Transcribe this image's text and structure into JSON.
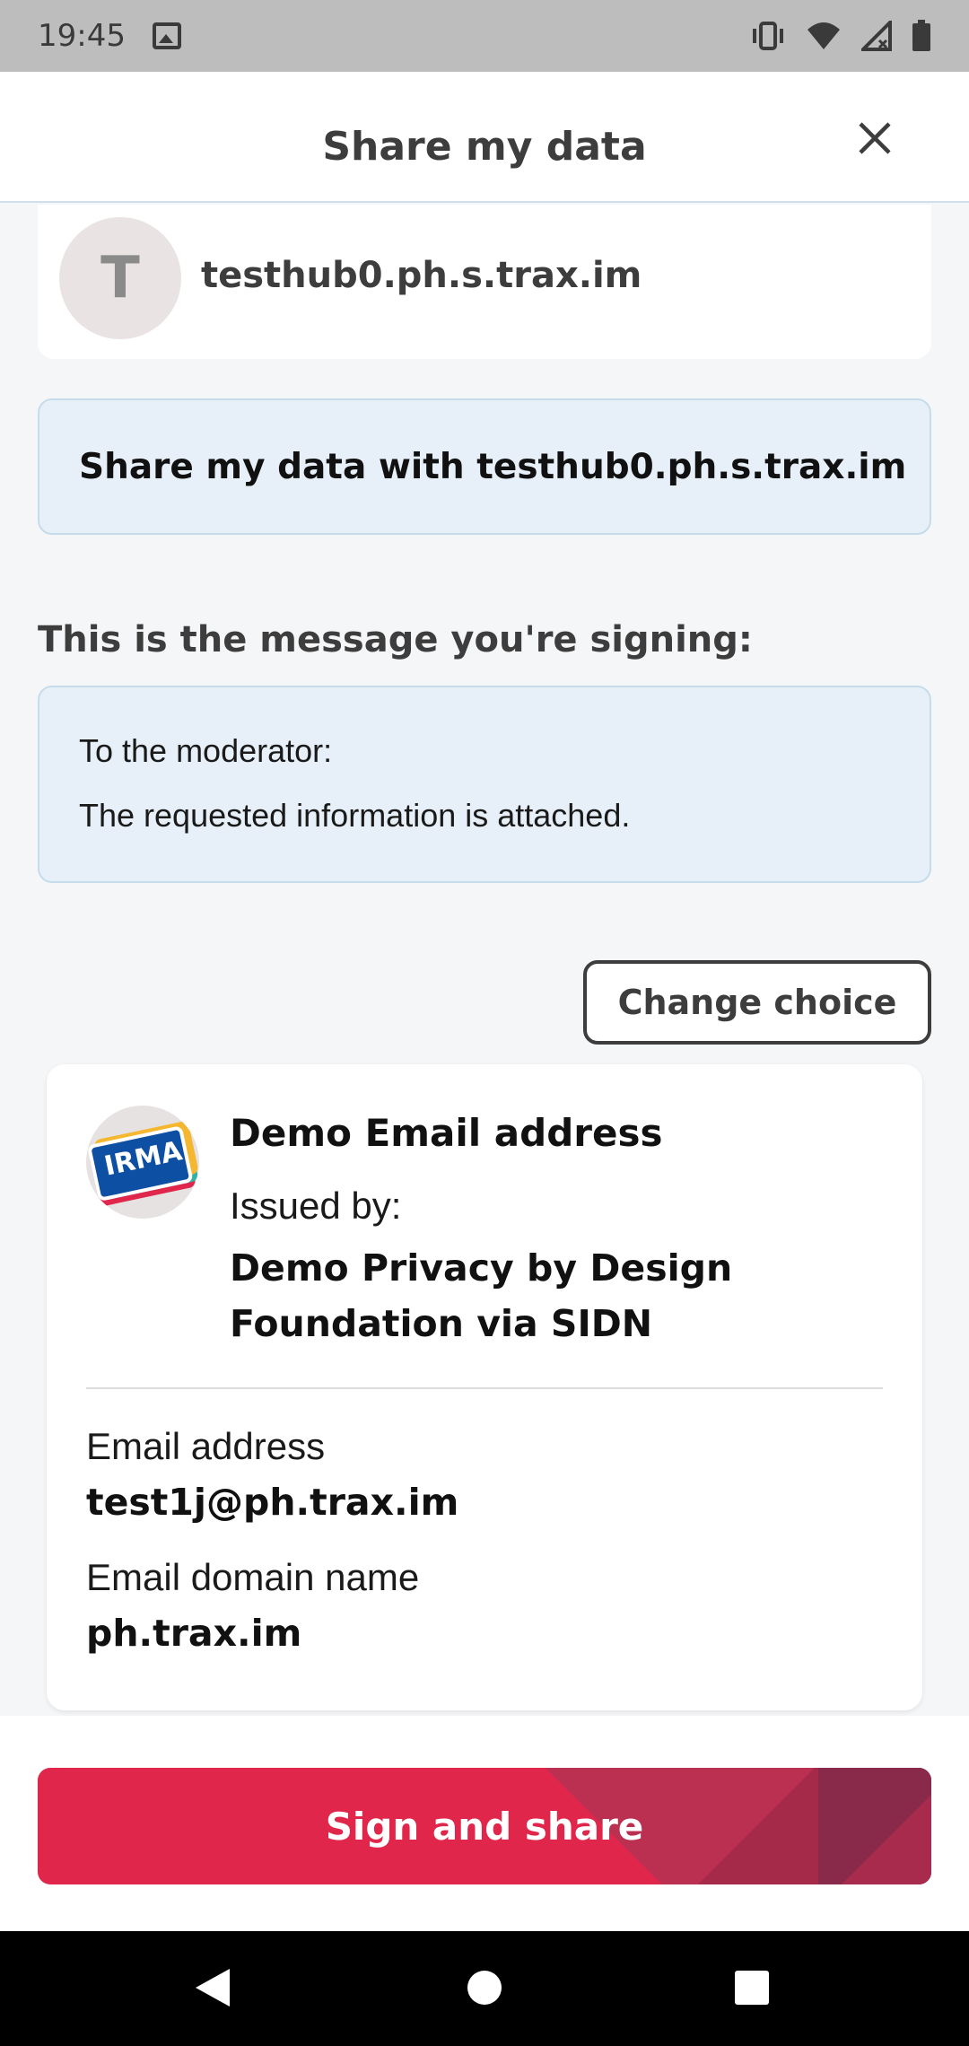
{
  "status_bar": {
    "time": "19:45",
    "icons": [
      "gallery-icon",
      "vibrate-icon",
      "wifi-icon",
      "signal-icon",
      "battery-icon"
    ]
  },
  "header": {
    "title": "Share my data",
    "close_icon": "close-icon"
  },
  "requestor": {
    "avatar_letter": "T",
    "name": "testhub0.ph.s.trax.im"
  },
  "share_box": {
    "text": "Share my data with testhub0.ph.s.trax.im"
  },
  "message": {
    "label": "This is the message you're signing:",
    "lines": [
      "To the moderator:",
      "The requested information is attached."
    ]
  },
  "change_choice": {
    "label": "Change choice"
  },
  "credential": {
    "logo_text": "IRMA",
    "title": "Demo Email address",
    "issued_by_label": "Issued by:",
    "issuer": "Demo Privacy by Design Foundation via SIDN",
    "attributes": [
      {
        "label": "Email address",
        "value": "test1j@ph.trax.im"
      },
      {
        "label": "Email domain name",
        "value": "ph.trax.im"
      }
    ]
  },
  "actions": {
    "sign_label": "Sign and share"
  },
  "colors": {
    "accent": "#e0264a",
    "info_box": "#e7f0f8",
    "status_bar": "#bdbdbd"
  },
  "nav": {
    "icons": [
      "back-icon",
      "home-icon",
      "recents-icon"
    ]
  }
}
